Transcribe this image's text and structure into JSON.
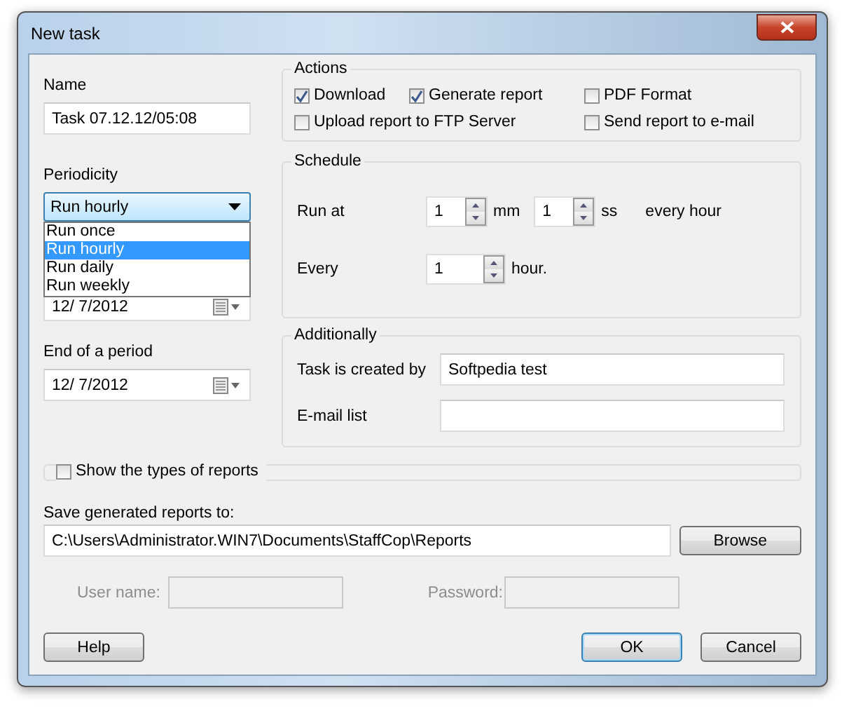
{
  "window": {
    "title": "New task"
  },
  "name": {
    "label": "Name",
    "value": "Task 07.12.12/05:08"
  },
  "periodicity": {
    "label": "Periodicity",
    "value": "Run hourly",
    "expanded": true,
    "options": [
      {
        "label": "Run once",
        "selected": false
      },
      {
        "label": "Run hourly",
        "selected": true
      },
      {
        "label": "Run daily",
        "selected": false
      },
      {
        "label": "Run weekly",
        "selected": false
      }
    ]
  },
  "start_date": {
    "value": "12/ 7/2012"
  },
  "end_of_period": {
    "label": "End of a period",
    "value": "12/ 7/2012"
  },
  "actions": {
    "title": "Actions",
    "items": [
      {
        "label": "Download",
        "checked": true
      },
      {
        "label": "Generate report",
        "checked": true
      },
      {
        "label": "PDF Format",
        "checked": false
      },
      {
        "label": "Upload report to FTP Server",
        "checked": false
      },
      {
        "label": "Send report to e-mail",
        "checked": false
      }
    ]
  },
  "schedule": {
    "title": "Schedule",
    "run_at_label": "Run at",
    "minutes": "1",
    "minutes_unit": "mm",
    "seconds": "1",
    "seconds_unit": "ss",
    "run_at_suffix": "every hour",
    "every_label": "Every",
    "every_value": "1",
    "every_unit": "hour."
  },
  "additionally": {
    "title": "Additionally",
    "created_by_label": "Task is created by",
    "created_by": "Softpedia test",
    "email_label": "E-mail list"
  },
  "show_types": {
    "label": "Show the types of reports",
    "checked": false
  },
  "save": {
    "label": "Save generated reports to:",
    "path": "C:\\Users\\Administrator.WIN7\\Documents\\StaffCop\\Reports",
    "browse": "Browse"
  },
  "credentials": {
    "disabled": true,
    "user_label": "User name:",
    "password_label": "Password:"
  },
  "buttons": [
    {
      "label": "Help",
      "default": false
    },
    {
      "label": "OK",
      "default": true
    },
    {
      "label": "Cancel",
      "default": false
    }
  ]
}
